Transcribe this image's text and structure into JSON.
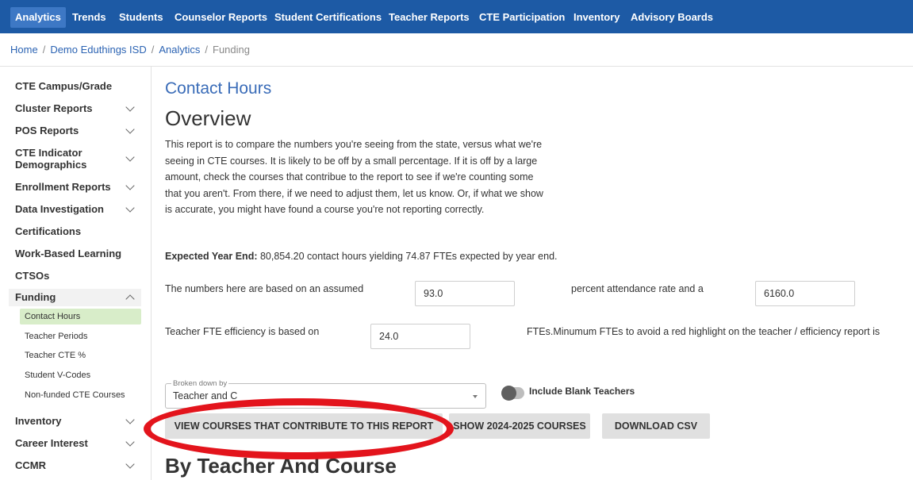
{
  "nav": {
    "items": [
      "Analytics",
      "Trends",
      "Students",
      "Counselor Reports",
      "Student Certifications",
      "Teacher Reports",
      "CTE Participation",
      "Inventory",
      "Advisory Boards"
    ],
    "active": "Analytics"
  },
  "breadcrumb": {
    "items": [
      "Home",
      "Demo Eduthings ISD",
      "Analytics"
    ],
    "current": "Funding",
    "separator": "/"
  },
  "sidebar": {
    "items": [
      {
        "label": "CTE Campus/Grade",
        "chevron": false
      },
      {
        "label": "Cluster Reports",
        "chevron": true
      },
      {
        "label": "POS Reports",
        "chevron": true
      },
      {
        "label": "CTE Indicator Demographics",
        "chevron": true
      },
      {
        "label": "Enrollment Reports",
        "chevron": true
      },
      {
        "label": "Data Investigation",
        "chevron": true
      },
      {
        "label": "Certifications",
        "chevron": false
      },
      {
        "label": "Work-Based Learning",
        "chevron": false
      },
      {
        "label": "CTSOs",
        "chevron": false
      },
      {
        "label": "Funding",
        "chevron": true,
        "open": true
      },
      {
        "label": "Inventory",
        "chevron": true
      },
      {
        "label": "Career Interest",
        "chevron": true
      },
      {
        "label": "CCMR",
        "chevron": true
      }
    ],
    "funding_sub_items": [
      "Contact Hours",
      "Teacher Periods",
      "Teacher CTE %",
      "Student V-Codes",
      "Non-funded CTE Courses"
    ],
    "active_sub_item": "Contact Hours"
  },
  "main": {
    "subtitle": "Contact Hours",
    "title": "Overview",
    "description": "This report is to compare the numbers you're seeing from the state, versus what we're seeing in CTE courses. It is likely to be off by a small percentage. If it is off by a large amount, check the courses that contribue to the report to see if we're counting some that you aren't. From there, if we need to adjust them, let us know. Or, if what we show is accurate, you might have found a course you're not reporting correctly.",
    "expected": {
      "label": "Expected Year End:",
      "text": " 80,854.20 contact hours yielding 74.87 FTEs expected by year end."
    },
    "assumed_label": "The numbers here are based on an assumed",
    "attendance_value": "93.0",
    "attendance_label": "percent attendance rate and a",
    "minutes_value": "6160.0",
    "efficiency_label": "Teacher FTE efficiency is based on",
    "efficiency_value": "24.0",
    "min_fte_label": "FTEs.Minumum FTEs to avoid a red highlight on the teacher / efficiency report is",
    "broken_down_by": {
      "legend": "Broken down by",
      "value": "Teacher and C"
    },
    "toggle": {
      "label": "Include Blank Teachers",
      "on": false
    },
    "buttons": {
      "view_courses": "VIEW COURSES THAT CONTRIBUTE TO THIS REPORT",
      "show_courses": "SHOW 2024-2025 COURSES",
      "download_csv": "DOWNLOAD CSV"
    },
    "section_title": "By Teacher And Course"
  },
  "colors": {
    "nav_bg": "#1d5aa5",
    "nav_active": "#3d78c5",
    "link": "#2b63b3",
    "subtitle": "#3a6cb8",
    "active_sub_bg": "#d8edc9",
    "button_bg": "#e0e0e0",
    "annotation": "#e3141c"
  }
}
